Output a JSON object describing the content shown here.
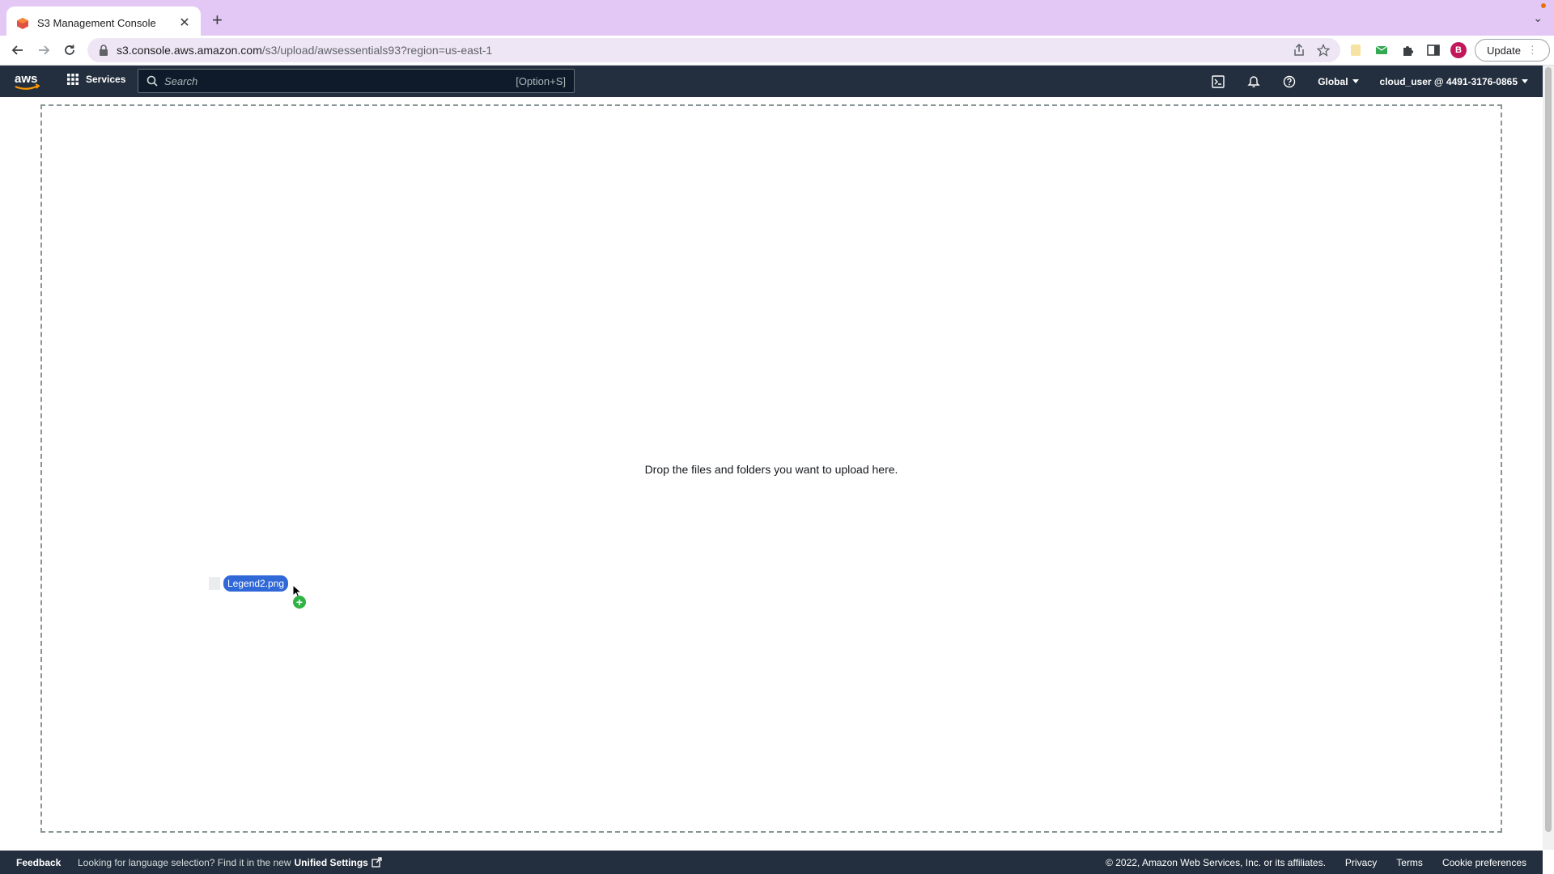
{
  "browser": {
    "tab_title": "S3 Management Console",
    "url_host": "s3.console.aws.amazon.com",
    "url_path": "/s3/upload/awsessentials93?region=us-east-1",
    "profile_initial": "B",
    "update_label": "Update"
  },
  "aws_nav": {
    "logo_text": "aws",
    "services_label": "Services",
    "search_placeholder": "Search",
    "search_shortcut": "[Option+S]",
    "region_label": "Global",
    "account_label": "cloud_user @ 4491-3176-0865"
  },
  "main": {
    "drop_message": "Drop the files and folders you want to upload here.",
    "dragged_file": "Legend2.png"
  },
  "footer": {
    "feedback": "Feedback",
    "language_prompt": "Looking for language selection? Find it in the new",
    "unified_settings": "Unified Settings",
    "copyright": "© 2022, Amazon Web Services, Inc. or its affiliates.",
    "privacy": "Privacy",
    "terms": "Terms",
    "cookie_preferences": "Cookie preferences"
  },
  "colors": {
    "tabstrip": "#e3c8f5",
    "aws_nav": "#232f3e",
    "drag_chip": "#3168d8",
    "copy_badge": "#2fb344"
  }
}
